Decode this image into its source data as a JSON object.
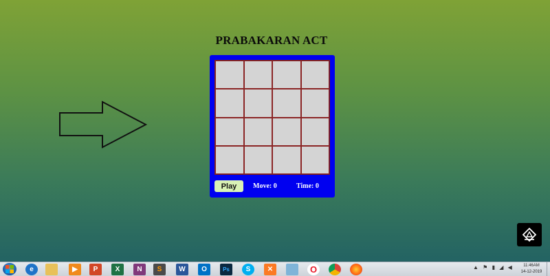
{
  "page": {
    "title": "PRABAKARAN ACT"
  },
  "game": {
    "rows": 4,
    "cols": 4,
    "play_label": "Play",
    "move_label": "Move:",
    "move_value": "0",
    "time_label": "Time:",
    "time_value": "0"
  },
  "taskbar": {
    "clock_time": "11:46AM",
    "clock_date": "14-12-2019",
    "apps": [
      {
        "name": "start",
        "icon": "windows-orb-icon"
      },
      {
        "name": "internet-explorer",
        "icon": "ie-icon"
      },
      {
        "name": "file-explorer",
        "icon": "folder-icon"
      },
      {
        "name": "media-player",
        "icon": "media-player-icon"
      },
      {
        "name": "powerpoint",
        "icon": "powerpoint-icon",
        "glyph": "P"
      },
      {
        "name": "excel",
        "icon": "excel-icon",
        "glyph": "X"
      },
      {
        "name": "onenote",
        "icon": "onenote-icon",
        "glyph": "N"
      },
      {
        "name": "sublime-text",
        "icon": "sublime-icon",
        "glyph": "S"
      },
      {
        "name": "word",
        "icon": "word-icon",
        "glyph": "W"
      },
      {
        "name": "outlook",
        "icon": "outlook-icon",
        "glyph": "O"
      },
      {
        "name": "photoshop",
        "icon": "photoshop-icon",
        "glyph": "Ps"
      },
      {
        "name": "skype",
        "icon": "skype-icon",
        "glyph": "S"
      },
      {
        "name": "xampp",
        "icon": "xampp-icon",
        "glyph": "✕"
      },
      {
        "name": "unknown-app",
        "icon": "app-icon"
      },
      {
        "name": "opera",
        "icon": "opera-icon",
        "glyph": "O"
      },
      {
        "name": "chrome",
        "icon": "chrome-icon"
      },
      {
        "name": "firefox",
        "icon": "firefox-icon"
      }
    ]
  },
  "colors": {
    "panel": "#0000f0",
    "tile": "#d4d4d4",
    "tile_border": "#8b2525",
    "play_button": "#d9f2b5"
  }
}
